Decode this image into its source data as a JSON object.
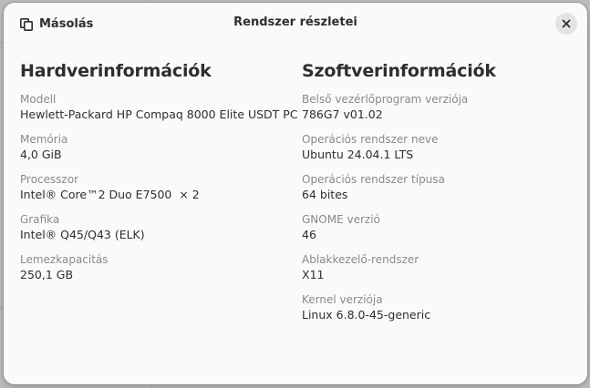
{
  "header": {
    "copy_label": "Másolás",
    "title": "Rendszer részletei"
  },
  "hardware": {
    "title": "Hardverinformációk",
    "rows": [
      {
        "label": "Modell",
        "value": "Hewlett-Packard HP Compaq 8000 Elite USDT PC"
      },
      {
        "label": "Memória",
        "value": "4,0 GiB"
      },
      {
        "label": "Processzor",
        "value": "Intel® Core™2 Duo E7500  × 2"
      },
      {
        "label": "Grafika",
        "value": "Intel® Q45/Q43 (ELK)"
      },
      {
        "label": "Lemezkapacitás",
        "value": "250,1 GB"
      }
    ]
  },
  "software": {
    "title": "Szoftverinformációk",
    "rows": [
      {
        "label": "Belső vezérlőprogram verziója",
        "value": "786G7 v01.02"
      },
      {
        "label": "Operációs rendszer neve",
        "value": "Ubuntu 24.04.1 LTS"
      },
      {
        "label": "Operációs rendszer típusa",
        "value": "64 bites"
      },
      {
        "label": "GNOME verzió",
        "value": "46"
      },
      {
        "label": "Ablakkezelő-rendszer",
        "value": "X11"
      },
      {
        "label": "Kernel verziója",
        "value": "Linux 6.8.0-45-generic"
      }
    ]
  },
  "icons": {
    "copy": "copy-icon",
    "close": "close-icon"
  },
  "colors": {
    "dialog_bg": "#fafafa",
    "text": "#2e2e2e",
    "label": "#8a8a8a",
    "close_bg": "#e4e4e4"
  }
}
